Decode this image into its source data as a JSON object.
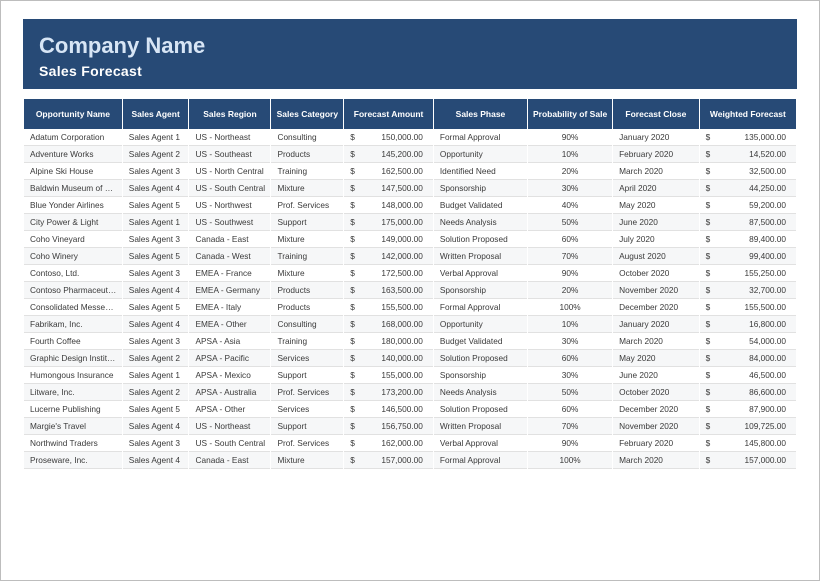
{
  "header": {
    "title": "Company Name",
    "subtitle": "Sales Forecast"
  },
  "columns": [
    "Opportunity Name",
    "Sales Agent",
    "Sales Region",
    "Sales Category",
    "Forecast Amount",
    "Sales Phase",
    "Probability of Sale",
    "Forecast Close",
    "Weighted Forecast"
  ],
  "currency_symbol": "$",
  "rows": [
    {
      "opportunity": "Adatum Corporation",
      "agent": "Sales Agent 1",
      "region": "US - Northeast",
      "category": "Consulting",
      "amount": "150,000.00",
      "phase": "Formal Approval",
      "probability": "90%",
      "close": "January 2020",
      "weighted": "135,000.00"
    },
    {
      "opportunity": "Adventure Works",
      "agent": "Sales Agent 2",
      "region": "US - Southeast",
      "category": "Products",
      "amount": "145,200.00",
      "phase": "Opportunity",
      "probability": "10%",
      "close": "February 2020",
      "weighted": "14,520.00"
    },
    {
      "opportunity": "Alpine Ski House",
      "agent": "Sales Agent 3",
      "region": "US - North Central",
      "category": "Training",
      "amount": "162,500.00",
      "phase": "Identified Need",
      "probability": "20%",
      "close": "March 2020",
      "weighted": "32,500.00"
    },
    {
      "opportunity": "Baldwin Museum of Science",
      "agent": "Sales Agent 4",
      "region": "US - South Central",
      "category": "Mixture",
      "amount": "147,500.00",
      "phase": "Sponsorship",
      "probability": "30%",
      "close": "April 2020",
      "weighted": "44,250.00"
    },
    {
      "opportunity": "Blue Yonder Airlines",
      "agent": "Sales Agent 5",
      "region": "US - Northwest",
      "category": "Prof. Services",
      "amount": "148,000.00",
      "phase": "Budget Validated",
      "probability": "40%",
      "close": "May 2020",
      "weighted": "59,200.00"
    },
    {
      "opportunity": "City Power & Light",
      "agent": "Sales Agent 1",
      "region": "US - Southwest",
      "category": "Support",
      "amount": "175,000.00",
      "phase": "Needs Analysis",
      "probability": "50%",
      "close": "June 2020",
      "weighted": "87,500.00"
    },
    {
      "opportunity": "Coho Vineyard",
      "agent": "Sales Agent 3",
      "region": "Canada - East",
      "category": "Mixture",
      "amount": "149,000.00",
      "phase": "Solution Proposed",
      "probability": "60%",
      "close": "July 2020",
      "weighted": "89,400.00"
    },
    {
      "opportunity": "Coho Winery",
      "agent": "Sales Agent 5",
      "region": "Canada - West",
      "category": "Training",
      "amount": "142,000.00",
      "phase": "Written Proposal",
      "probability": "70%",
      "close": "August 2020",
      "weighted": "99,400.00"
    },
    {
      "opportunity": "Contoso, Ltd.",
      "agent": "Sales Agent 3",
      "region": "EMEA - France",
      "category": "Mixture",
      "amount": "172,500.00",
      "phase": "Verbal Approval",
      "probability": "90%",
      "close": "October 2020",
      "weighted": "155,250.00"
    },
    {
      "opportunity": "Contoso Pharmaceuticals",
      "agent": "Sales Agent 4",
      "region": "EMEA - Germany",
      "category": "Products",
      "amount": "163,500.00",
      "phase": "Sponsorship",
      "probability": "20%",
      "close": "November 2020",
      "weighted": "32,700.00"
    },
    {
      "opportunity": "Consolidated Messenger",
      "agent": "Sales Agent 5",
      "region": "EMEA - Italy",
      "category": "Products",
      "amount": "155,500.00",
      "phase": "Formal Approval",
      "probability": "100%",
      "close": "December 2020",
      "weighted": "155,500.00"
    },
    {
      "opportunity": "Fabrikam, Inc.",
      "agent": "Sales Agent 4",
      "region": "EMEA - Other",
      "category": "Consulting",
      "amount": "168,000.00",
      "phase": "Opportunity",
      "probability": "10%",
      "close": "January 2020",
      "weighted": "16,800.00"
    },
    {
      "opportunity": "Fourth Coffee",
      "agent": "Sales Agent 3",
      "region": "APSA - Asia",
      "category": "Training",
      "amount": "180,000.00",
      "phase": "Budget Validated",
      "probability": "30%",
      "close": "March 2020",
      "weighted": "54,000.00"
    },
    {
      "opportunity": "Graphic Design Institute",
      "agent": "Sales Agent 2",
      "region": "APSA - Pacific",
      "category": "Services",
      "amount": "140,000.00",
      "phase": "Solution Proposed",
      "probability": "60%",
      "close": "May 2020",
      "weighted": "84,000.00"
    },
    {
      "opportunity": "Humongous Insurance",
      "agent": "Sales Agent 1",
      "region": "APSA - Mexico",
      "category": "Support",
      "amount": "155,000.00",
      "phase": "Sponsorship",
      "probability": "30%",
      "close": "June 2020",
      "weighted": "46,500.00"
    },
    {
      "opportunity": "Litware, Inc.",
      "agent": "Sales Agent 2",
      "region": "APSA - Australia",
      "category": "Prof. Services",
      "amount": "173,200.00",
      "phase": "Needs Analysis",
      "probability": "50%",
      "close": "October 2020",
      "weighted": "86,600.00"
    },
    {
      "opportunity": "Lucerne Publishing",
      "agent": "Sales Agent 5",
      "region": "APSA - Other",
      "category": "Services",
      "amount": "146,500.00",
      "phase": "Solution Proposed",
      "probability": "60%",
      "close": "December 2020",
      "weighted": "87,900.00"
    },
    {
      "opportunity": "Margie's Travel",
      "agent": "Sales Agent 4",
      "region": "US - Northeast",
      "category": "Support",
      "amount": "156,750.00",
      "phase": "Written Proposal",
      "probability": "70%",
      "close": "November 2020",
      "weighted": "109,725.00"
    },
    {
      "opportunity": "Northwind Traders",
      "agent": "Sales Agent 3",
      "region": "US - South Central",
      "category": "Prof. Services",
      "amount": "162,000.00",
      "phase": "Verbal Approval",
      "probability": "90%",
      "close": "February 2020",
      "weighted": "145,800.00"
    },
    {
      "opportunity": "Proseware, Inc.",
      "agent": "Sales Agent 4",
      "region": "Canada - East",
      "category": "Mixture",
      "amount": "157,000.00",
      "phase": "Formal Approval",
      "probability": "100%",
      "close": "March 2020",
      "weighted": "157,000.00"
    }
  ]
}
